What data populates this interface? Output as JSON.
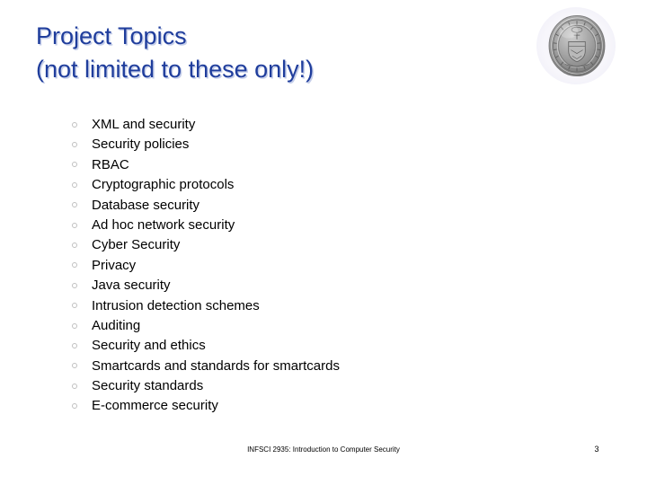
{
  "slide": {
    "background_color": "#ffffff",
    "title": {
      "color": "#1f3d9c",
      "line1": "Project Topics",
      "line2": "(not limited to these only!)"
    },
    "logo": {
      "name": "university-seal",
      "alt": "University of Pittsburgh seal",
      "outer_ring_text": "UNIVERSITY OF PITTSBURGH",
      "color": "#8a8a8a",
      "halo_color": "#f5f4fb"
    },
    "bullet_list": {
      "marker": "hollow-circle",
      "marker_color": "#c0c0c0",
      "text_color": "#000000",
      "items": [
        "XML and security",
        "Security policies",
        "RBAC",
        "Cryptographic protocols",
        "Database security",
        "Ad hoc network security",
        "Cyber Security",
        "Privacy",
        "Java security",
        "Intrusion detection schemes",
        "Auditing",
        "Security and ethics",
        "Smartcards and standards for smartcards",
        "Security standards",
        "E-commerce security"
      ]
    },
    "footer": {
      "course": "INFSCI 2935: Introduction to Computer Security",
      "page_number": "3"
    }
  }
}
